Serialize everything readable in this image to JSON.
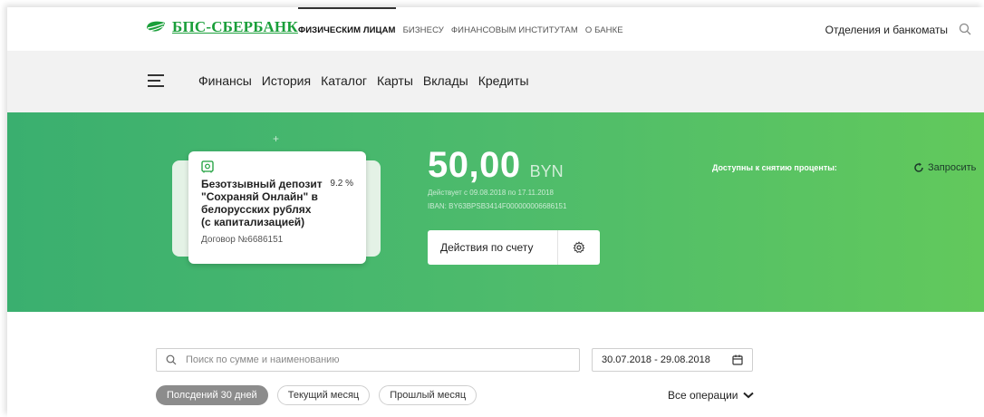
{
  "header": {
    "logo_text": "БПС-СБЕРБАНК",
    "nav": [
      "ФИЗИЧЕСКИМ ЛИЦАМ",
      "БИЗНЕСУ",
      "ФИНАНСОВЫМ ИНСТИТУТАМ",
      "О БАНКЕ"
    ],
    "branches_label": "Отделения и банкоматы"
  },
  "menu": {
    "items": [
      "Финансы",
      "История",
      "Каталог",
      "Карты",
      "Вклады",
      "Кредиты"
    ]
  },
  "deposit": {
    "title": "Безотзывный депозит \"Сохраняй Онлайн\" в белорусских рублях (с капитализацией)",
    "rate": "9.2 %",
    "contract": "Договор №6686151",
    "plus": "+",
    "amount": "50,00",
    "currency": "BYN",
    "valid": "Действует с 09.08.2018 по 17.11.2018",
    "iban": "IBAN: BY63BPSB3414F000000006686151",
    "actions_label": "Действия по счету",
    "available_label": "Доступны к снятию проценты:",
    "request_label": "Запросить"
  },
  "filters": {
    "search_placeholder": "Поиск по сумме и наименованию",
    "date_range": "30.07.2018 - 29.08.2018",
    "chips": [
      "Полсдений 30 дней",
      "Текущий месяц",
      "Прошлый месяц"
    ],
    "operations_label": "Все операции"
  },
  "colors": {
    "brand_green": "#1a9f3a",
    "hero_start": "#3aaf6f",
    "hero_end": "#62c95c"
  }
}
